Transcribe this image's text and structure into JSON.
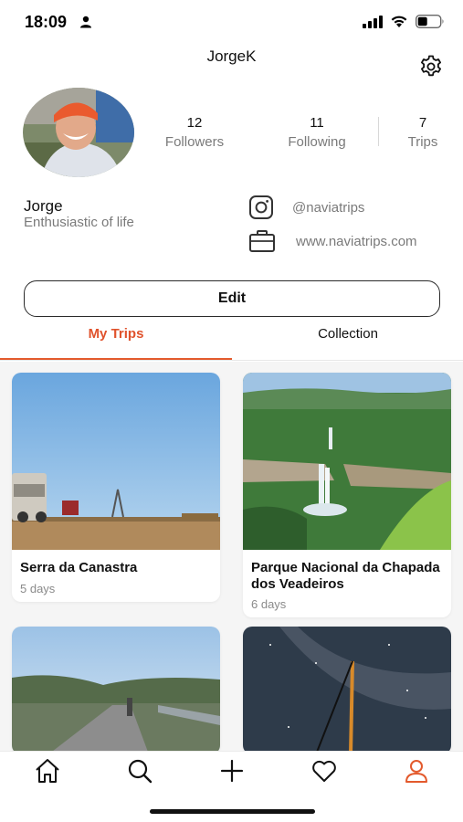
{
  "status_bar": {
    "time": "18:09"
  },
  "header": {
    "username": "JorgeK"
  },
  "stats": {
    "followers": {
      "value": "12",
      "label": "Followers"
    },
    "following": {
      "value": "11",
      "label": "Following"
    },
    "trips": {
      "value": "7",
      "label": "Trips"
    }
  },
  "profile": {
    "name": "Jorge",
    "bio": "Enthusiastic of life"
  },
  "social": {
    "instagram": "@naviatrips",
    "website": "www.naviatrips.com"
  },
  "edit_label": "Edit",
  "tabs": [
    {
      "label": "My Trips",
      "active": true
    },
    {
      "label": "Collection",
      "active": false
    }
  ],
  "trips": [
    {
      "title": "Serra da Canastra",
      "days": "5 days"
    },
    {
      "title": "Parque Nacional da Chapada dos Veadeiros",
      "days": "6 days"
    }
  ],
  "bottom_nav": [
    {
      "icon": "home-icon"
    },
    {
      "icon": "search-icon"
    },
    {
      "icon": "plus-icon"
    },
    {
      "icon": "heart-icon"
    },
    {
      "icon": "profile-icon",
      "active": true
    }
  ],
  "colors": {
    "accent": "#e35a2d",
    "muted_text": "#7a7a7a"
  }
}
